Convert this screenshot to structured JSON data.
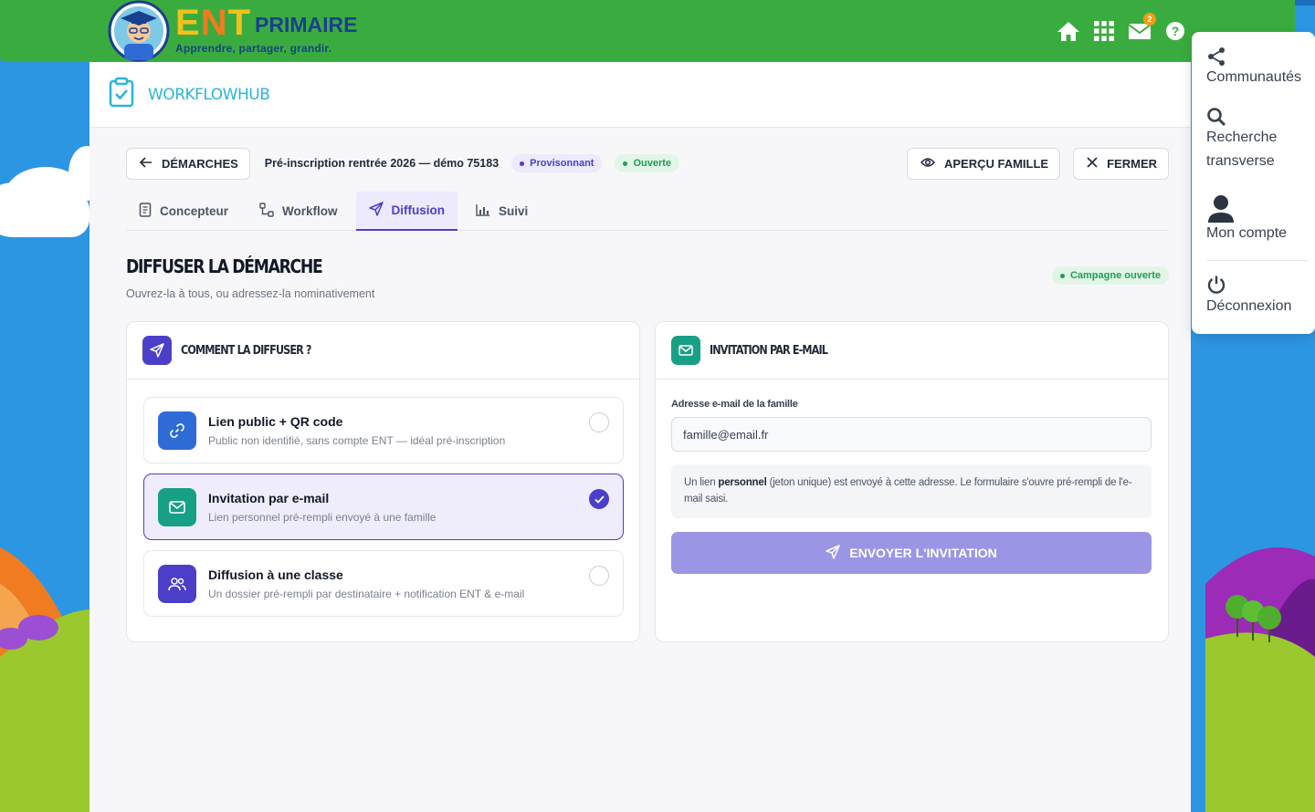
{
  "header": {
    "logo_ent": "ENT",
    "logo_primaire": "PRIMAIRE",
    "logo_tagline": "Apprendre, partager, grandir.",
    "mail_count": "2",
    "icons": [
      "home-icon",
      "apps-grid-icon",
      "mail-icon",
      "help-icon"
    ]
  },
  "app": {
    "name": "WORKFLOWHUB"
  },
  "toolbar": {
    "back_label": "DÉMARCHES",
    "doc_title": "Pré-inscription rentrée 2026 — démo 75183",
    "badge_provision": "Provisonnant",
    "badge_status": "Ouverte",
    "preview_label": "APERÇU FAMILLE",
    "close_label": "FERMER"
  },
  "tabs": [
    {
      "label": "Concepteur",
      "icon": "document-icon",
      "active": false
    },
    {
      "label": "Workflow",
      "icon": "workflow-icon",
      "active": false
    },
    {
      "label": "Diffusion",
      "icon": "send-icon",
      "active": true
    },
    {
      "label": "Suivi",
      "icon": "chart-icon",
      "active": false
    }
  ],
  "section": {
    "title": "DIFFUSER LA DÉMARCHE",
    "subtitle": "Ouvrez-la à tous, ou adressez-la nominativement",
    "campaign_badge": "Campagne ouverte"
  },
  "left_card": {
    "title": "COMMENT LA DIFFUSER ?",
    "options": [
      {
        "title": "Lien public + QR code",
        "desc": "Public non identifié, sans compte ENT — idéal pré-inscription",
        "selected": false
      },
      {
        "title": "Invitation par e-mail",
        "desc": "Lien personnel pré-rempli envoyé à une famille",
        "selected": true
      },
      {
        "title": "Diffusion à une classe",
        "desc": "Un dossier pré-rempli par destinataire + notification ENT & e-mail",
        "selected": false
      }
    ]
  },
  "right_card": {
    "title": "INVITATION PAR E-MAIL",
    "field_label": "Adresse e-mail de la famille",
    "email_value": "famille@email.fr",
    "info_before": "Un lien ",
    "info_bold": "personnel",
    "info_after": " (jeton unique) est envoyé à cette adresse. Le formulaire s'ouvre pré-rempli de l'e-mail saisi.",
    "send_label": "ENVOYER L'INVITATION"
  },
  "menu": {
    "communautes": "Communautés",
    "recherche_1": "Recherche",
    "recherche_2": "transverse",
    "compte": "Mon compte",
    "deconnexion": "Déconnexion"
  },
  "colors": {
    "topbar": "#3aac3f",
    "accent": "#4b3fc9",
    "teal": "#17a085",
    "blue": "#2e6bd6",
    "send_button": "#9b95e6"
  }
}
